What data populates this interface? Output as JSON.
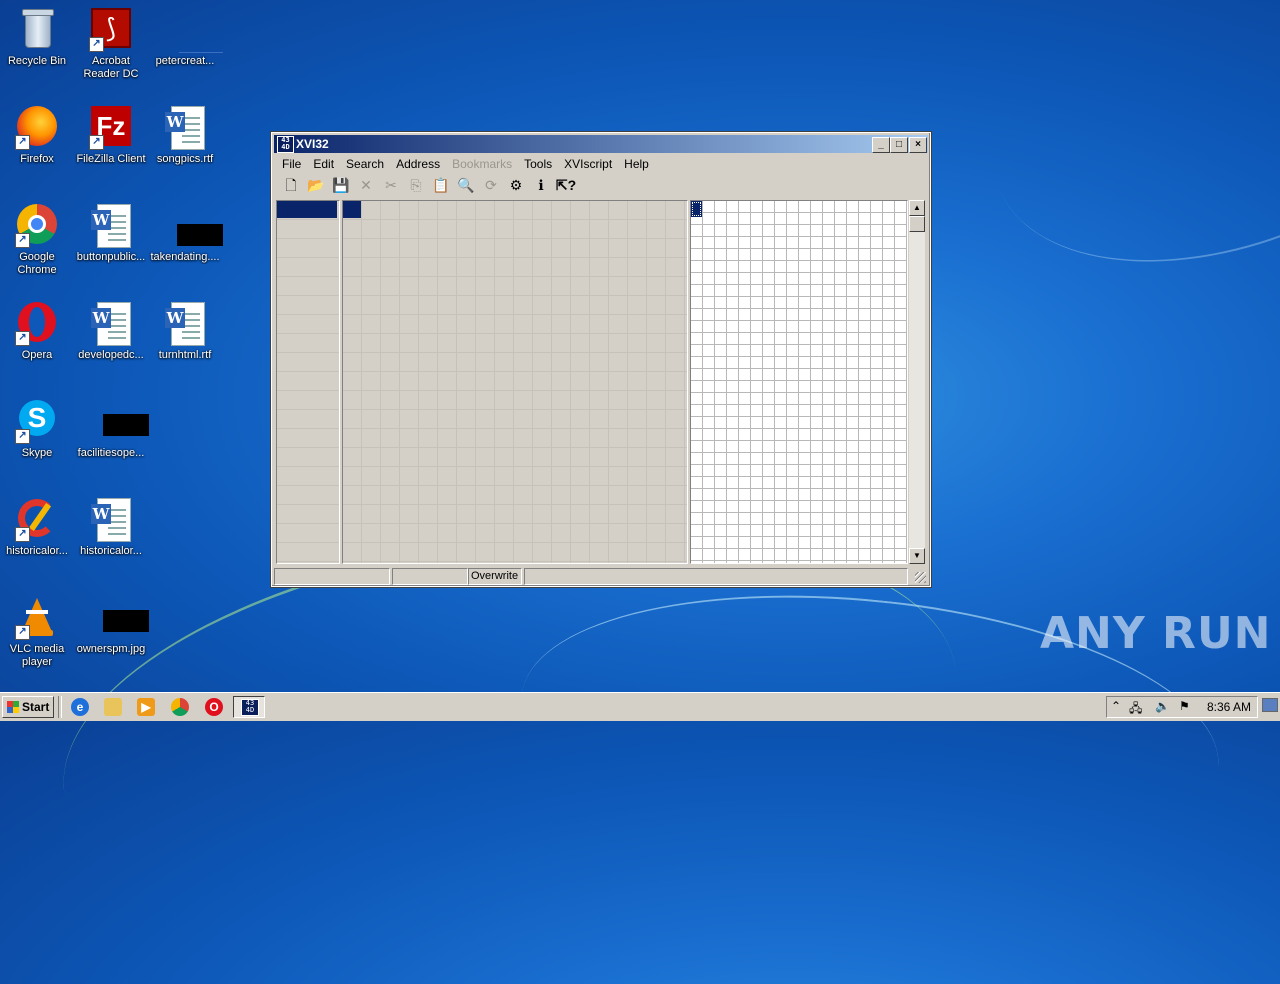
{
  "desktop": {
    "icons": [
      {
        "label": "Recycle Bin",
        "icon": "recycle-bin-icon"
      },
      {
        "label": "Acrobat Reader DC",
        "icon": "acrobat-icon"
      },
      {
        "label": "petercreat...",
        "icon": "file-icon"
      },
      {
        "label": "Firefox",
        "icon": "firefox-icon"
      },
      {
        "label": "FileZilla Client",
        "icon": "filezilla-icon"
      },
      {
        "label": "songpics.rtf",
        "icon": "word-doc-icon"
      },
      {
        "label": "Google Chrome",
        "icon": "chrome-icon"
      },
      {
        "label": "buttonpublic...",
        "icon": "word-doc-icon"
      },
      {
        "label": "takendating....",
        "icon": "black-thumbnail-icon"
      },
      {
        "label": "Opera",
        "icon": "opera-icon"
      },
      {
        "label": "developedc...",
        "icon": "word-doc-icon"
      },
      {
        "label": "turnhtml.rtf",
        "icon": "word-doc-icon"
      },
      {
        "label": "Skype",
        "icon": "skype-icon"
      },
      {
        "label": "facilitiesope...",
        "icon": "black-thumbnail-icon"
      },
      {
        "label": "CCleaner",
        "icon": "ccleaner-icon"
      },
      {
        "label": "historicalor...",
        "icon": "word-doc-icon"
      },
      {
        "label": "VLC media player",
        "icon": "vlc-icon"
      },
      {
        "label": "ownerspm.jpg",
        "icon": "black-thumbnail-icon"
      }
    ],
    "watermark": "ANY RUN"
  },
  "window": {
    "title": "XVI32",
    "app_icon_text": "43 4D",
    "controls": {
      "minimize": "_",
      "maximize": "□",
      "close": "×"
    },
    "menu": [
      {
        "label": "File",
        "enabled": true
      },
      {
        "label": "Edit",
        "enabled": true
      },
      {
        "label": "Search",
        "enabled": true
      },
      {
        "label": "Address",
        "enabled": true
      },
      {
        "label": "Bookmarks",
        "enabled": false
      },
      {
        "label": "Tools",
        "enabled": true
      },
      {
        "label": "XVIscript",
        "enabled": true
      },
      {
        "label": "Help",
        "enabled": true
      }
    ],
    "toolbar": [
      {
        "name": "new-file-icon",
        "glyph": "🗋",
        "enabled": true
      },
      {
        "name": "open-folder-icon",
        "glyph": "📂",
        "enabled": true
      },
      {
        "name": "save-icon",
        "glyph": "💾",
        "enabled": false
      },
      {
        "name": "close-file-icon",
        "glyph": "✕",
        "enabled": false
      },
      {
        "name": "cut-icon",
        "glyph": "✂",
        "enabled": false
      },
      {
        "name": "copy-icon",
        "glyph": "⎘",
        "enabled": false
      },
      {
        "name": "paste-icon",
        "glyph": "📋",
        "enabled": false
      },
      {
        "name": "find-icon",
        "glyph": "🔍",
        "enabled": false
      },
      {
        "name": "replace-icon",
        "glyph": "⟳",
        "enabled": false
      },
      {
        "name": "settings-icon",
        "glyph": "⚙",
        "enabled": true
      },
      {
        "name": "info-icon",
        "glyph": "ℹ",
        "enabled": true
      },
      {
        "name": "context-help-icon",
        "glyph": "⇱?",
        "enabled": true
      }
    ],
    "status": {
      "mode": "Overwrite"
    }
  },
  "taskbar": {
    "start_label": "Start",
    "quicklaunch": [
      "ie-icon",
      "explorer-icon",
      "media-player-icon",
      "chrome-icon",
      "opera-icon"
    ],
    "active_task_icon_text": "43 4D",
    "clock": "8:36 AM"
  }
}
